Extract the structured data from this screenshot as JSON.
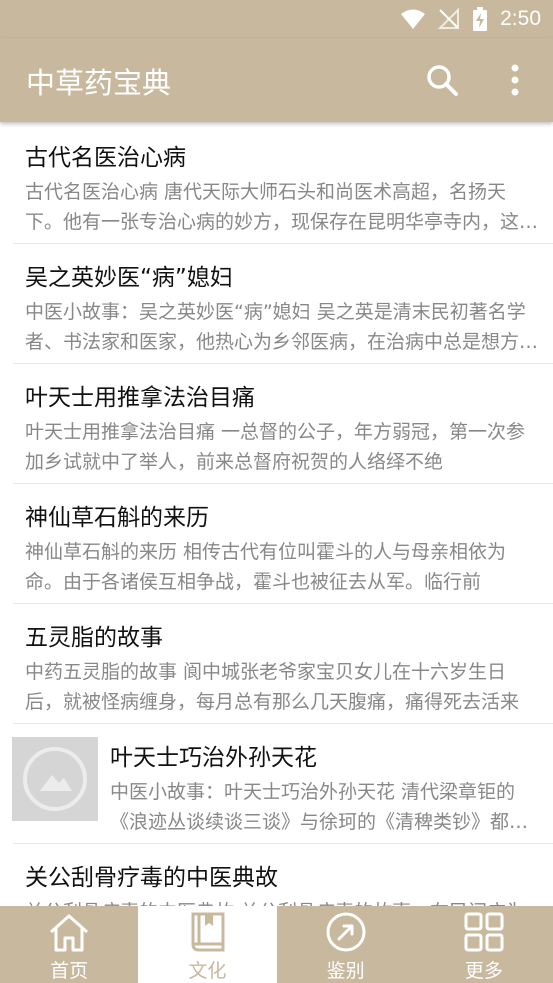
{
  "status": {
    "time": "2:50"
  },
  "app": {
    "title": "中草药宝典"
  },
  "icons": {
    "search": "search-icon",
    "more": "more-vert-icon",
    "placeholder": "image-placeholder-icon"
  },
  "colors": {
    "theme": "#c8b89d",
    "title_text": "#111111",
    "desc_text": "#888888"
  },
  "articles": [
    {
      "title": "古代名医治心病",
      "desc": "古代名医治心病 唐代天际大师石头和尚医术高超，名扬天下。他有一张专治心病的妙方，现保存在昆明华亭寺内，这张妙方是："
    },
    {
      "title": "吴之英妙医“病”媳妇",
      "desc": "中医小故事：吴之英妙医“病”媳妇 吴之英是清末民初著名学者、书法家和医家，他热心为乡邻医病，在治病中总是想方设法"
    },
    {
      "title": "叶天士用推拿法治目痛",
      "desc": "叶天士用推拿法治目痛 一总督的公子，年方弱冠，第一次参加乡试就中了举人，前来总督府祝贺的人络绎不绝"
    },
    {
      "title": "神仙草石斛的来历",
      "desc": "神仙草石斛的来历 相传古代有位叫霍斗的人与母亲相依为命。由于各诸侯互相争战，霍斗也被征去从军。临行前"
    },
    {
      "title": "五灵脂的故事",
      "desc": "中药五灵脂的故事 阆中城张老爷家宝贝女儿在十六岁生日后，就被怪病缠身，每月总有那么几天腹痛，痛得死去活来"
    },
    {
      "title": "叶天士巧治外孙天花",
      "desc": "中医小故事：叶天士巧治外孙天花 清代梁章钜的《浪迹丛谈续谈三谈》与徐珂的《清稗类钞》都记载"
    },
    {
      "title": "关公刮骨疗毒的中医典故",
      "desc": "关公刮骨疗毒的中医典故 关公刮骨疗毒的故事，在民间广为流传"
    }
  ],
  "tabs": [
    {
      "label": "首页",
      "icon": "home-icon"
    },
    {
      "label": "文化",
      "icon": "book-icon"
    },
    {
      "label": "鉴别",
      "icon": "compass-icon"
    },
    {
      "label": "更多",
      "icon": "grid-icon"
    }
  ]
}
